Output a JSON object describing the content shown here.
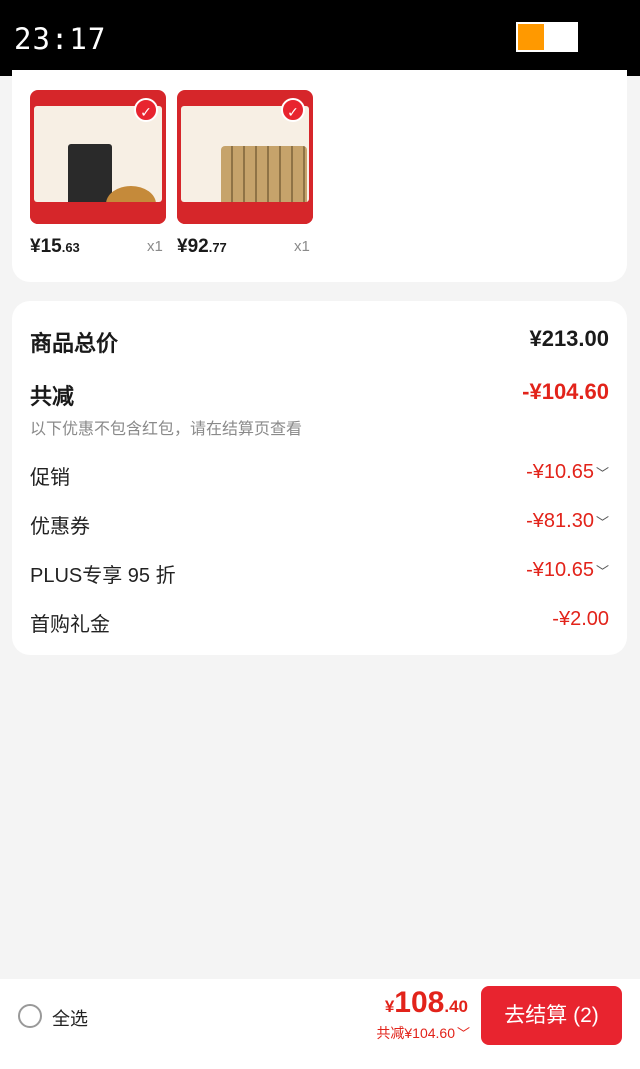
{
  "status_bar": {
    "time": "23:17"
  },
  "products": [
    {
      "price_int": "¥15",
      "price_dec": ".63",
      "qty": "x1"
    },
    {
      "price_int": "¥92",
      "price_dec": ".77",
      "qty": "x1"
    }
  ],
  "summary": {
    "total_label": "商品总价",
    "total_value": "¥213.00",
    "reduce_label": "共减",
    "reduce_value": "-¥104.60",
    "note": "以下优惠不包含红包，请在结算页查看",
    "items": [
      {
        "label": "促销",
        "value": "-¥10.65"
      },
      {
        "label": "优惠券",
        "value": "-¥81.30"
      },
      {
        "label": "PLUS专享 95 折",
        "value": "-¥10.65"
      },
      {
        "label": "首购礼金",
        "value": "-¥2.00"
      }
    ]
  },
  "bottom_bar": {
    "select_all": "全选",
    "currency": "¥",
    "total_int": "108",
    "total_dec": ".40",
    "saved": "共减¥104.60",
    "checkout": "去结算 (2)"
  },
  "colors": {
    "accent": "#e8242f",
    "battery": "#ff9900"
  }
}
